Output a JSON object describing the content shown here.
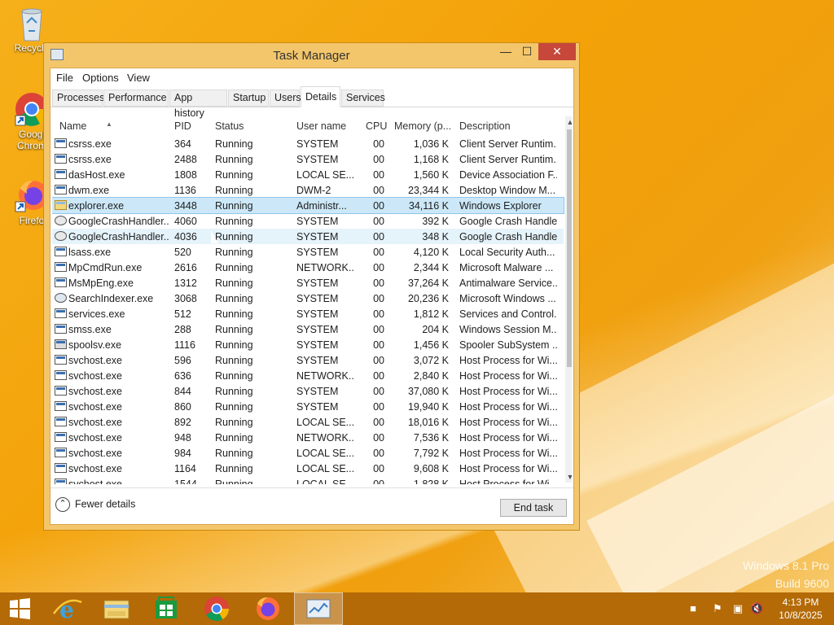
{
  "desktop": {
    "icons": [
      {
        "label": "Recycle",
        "icon": "recycle-bin-icon"
      },
      {
        "label": "Googl Chrom",
        "icon": "chrome-icon"
      },
      {
        "label": "Firefo",
        "icon": "firefox-icon"
      }
    ],
    "watermark_line1": "Windows 8.1 Pro",
    "watermark_line2": "Build 9600"
  },
  "window": {
    "title": "Task Manager",
    "minimize_glyph": "—",
    "maximize_glyph": "☐",
    "close_glyph": "✕",
    "menu": [
      "File",
      "Options",
      "View"
    ],
    "tabs": [
      "Processes",
      "Performance",
      "App history",
      "Startup",
      "Users",
      "Details",
      "Services"
    ],
    "active_tab": "Details",
    "columns": [
      "Name",
      "PID",
      "Status",
      "User name",
      "CPU",
      "Memory (p...",
      "Description"
    ],
    "rows": [
      {
        "name": "csrss.exe",
        "pid": "364",
        "status": "Running",
        "user": "SYSTEM",
        "cpu": "00",
        "mem": "1,036 K",
        "desc": "Client Server Runtim..."
      },
      {
        "name": "csrss.exe",
        "pid": "2488",
        "status": "Running",
        "user": "SYSTEM",
        "cpu": "00",
        "mem": "1,168 K",
        "desc": "Client Server Runtim..."
      },
      {
        "name": "dasHost.exe",
        "pid": "1808",
        "status": "Running",
        "user": "LOCAL SE...",
        "cpu": "00",
        "mem": "1,560 K",
        "desc": "Device Association F..."
      },
      {
        "name": "dwm.exe",
        "pid": "1136",
        "status": "Running",
        "user": "DWM-2",
        "cpu": "00",
        "mem": "23,344 K",
        "desc": "Desktop Window M..."
      },
      {
        "name": "explorer.exe",
        "pid": "3448",
        "status": "Running",
        "user": "Administr...",
        "cpu": "00",
        "mem": "34,116 K",
        "desc": "Windows Explorer"
      },
      {
        "name": "GoogleCrashHandler...",
        "pid": "4060",
        "status": "Running",
        "user": "SYSTEM",
        "cpu": "00",
        "mem": "392 K",
        "desc": "Google Crash Handler"
      },
      {
        "name": "GoogleCrashHandler...",
        "pid": "4036",
        "status": "Running",
        "user": "SYSTEM",
        "cpu": "00",
        "mem": "348 K",
        "desc": "Google Crash Handler"
      },
      {
        "name": "lsass.exe",
        "pid": "520",
        "status": "Running",
        "user": "SYSTEM",
        "cpu": "00",
        "mem": "4,120 K",
        "desc": "Local Security Auth..."
      },
      {
        "name": "MpCmdRun.exe",
        "pid": "2616",
        "status": "Running",
        "user": "NETWORK...",
        "cpu": "00",
        "mem": "2,344 K",
        "desc": "Microsoft Malware ..."
      },
      {
        "name": "MsMpEng.exe",
        "pid": "1312",
        "status": "Running",
        "user": "SYSTEM",
        "cpu": "00",
        "mem": "37,264 K",
        "desc": "Antimalware Service..."
      },
      {
        "name": "SearchIndexer.exe",
        "pid": "3068",
        "status": "Running",
        "user": "SYSTEM",
        "cpu": "00",
        "mem": "20,236 K",
        "desc": "Microsoft Windows ..."
      },
      {
        "name": "services.exe",
        "pid": "512",
        "status": "Running",
        "user": "SYSTEM",
        "cpu": "00",
        "mem": "1,812 K",
        "desc": "Services and Control..."
      },
      {
        "name": "smss.exe",
        "pid": "288",
        "status": "Running",
        "user": "SYSTEM",
        "cpu": "00",
        "mem": "204 K",
        "desc": "Windows Session M..."
      },
      {
        "name": "spoolsv.exe",
        "pid": "1116",
        "status": "Running",
        "user": "SYSTEM",
        "cpu": "00",
        "mem": "1,456 K",
        "desc": "Spooler SubSystem ..."
      },
      {
        "name": "svchost.exe",
        "pid": "596",
        "status": "Running",
        "user": "SYSTEM",
        "cpu": "00",
        "mem": "3,072 K",
        "desc": "Host Process for Wi..."
      },
      {
        "name": "svchost.exe",
        "pid": "636",
        "status": "Running",
        "user": "NETWORK...",
        "cpu": "00",
        "mem": "2,840 K",
        "desc": "Host Process for Wi..."
      },
      {
        "name": "svchost.exe",
        "pid": "844",
        "status": "Running",
        "user": "SYSTEM",
        "cpu": "00",
        "mem": "37,080 K",
        "desc": "Host Process for Wi..."
      },
      {
        "name": "svchost.exe",
        "pid": "860",
        "status": "Running",
        "user": "SYSTEM",
        "cpu": "00",
        "mem": "19,940 K",
        "desc": "Host Process for Wi..."
      },
      {
        "name": "svchost.exe",
        "pid": "892",
        "status": "Running",
        "user": "LOCAL SE...",
        "cpu": "00",
        "mem": "18,016 K",
        "desc": "Host Process for Wi..."
      },
      {
        "name": "svchost.exe",
        "pid": "948",
        "status": "Running",
        "user": "NETWORK...",
        "cpu": "00",
        "mem": "7,536 K",
        "desc": "Host Process for Wi..."
      },
      {
        "name": "svchost.exe",
        "pid": "984",
        "status": "Running",
        "user": "LOCAL SE...",
        "cpu": "00",
        "mem": "7,792 K",
        "desc": "Host Process for Wi..."
      },
      {
        "name": "svchost.exe",
        "pid": "1164",
        "status": "Running",
        "user": "LOCAL SE...",
        "cpu": "00",
        "mem": "9,608 K",
        "desc": "Host Process for Wi..."
      },
      {
        "name": "svchost.exe",
        "pid": "1544",
        "status": "Running",
        "user": "LOCAL SE...",
        "cpu": "00",
        "mem": "1,828 K",
        "desc": "Host Process for Wi..."
      }
    ],
    "selected_row": "explorer.exe",
    "fewer_details": "Fewer details",
    "end_task": "End task"
  },
  "taskbar": {
    "items": [
      "start-icon",
      "internet-explorer-icon",
      "file-explorer-icon",
      "store-icon",
      "chrome-icon",
      "firefox-icon",
      "task-manager-icon"
    ],
    "clock_time": "4:13 PM",
    "clock_date": "10/8/2025"
  },
  "colors": {
    "desktop": "#f3a108",
    "taskbar": "#b46a06",
    "window_frame": "#f3c66b",
    "close_button": "#c7473b",
    "selection": "#cce8f8"
  }
}
